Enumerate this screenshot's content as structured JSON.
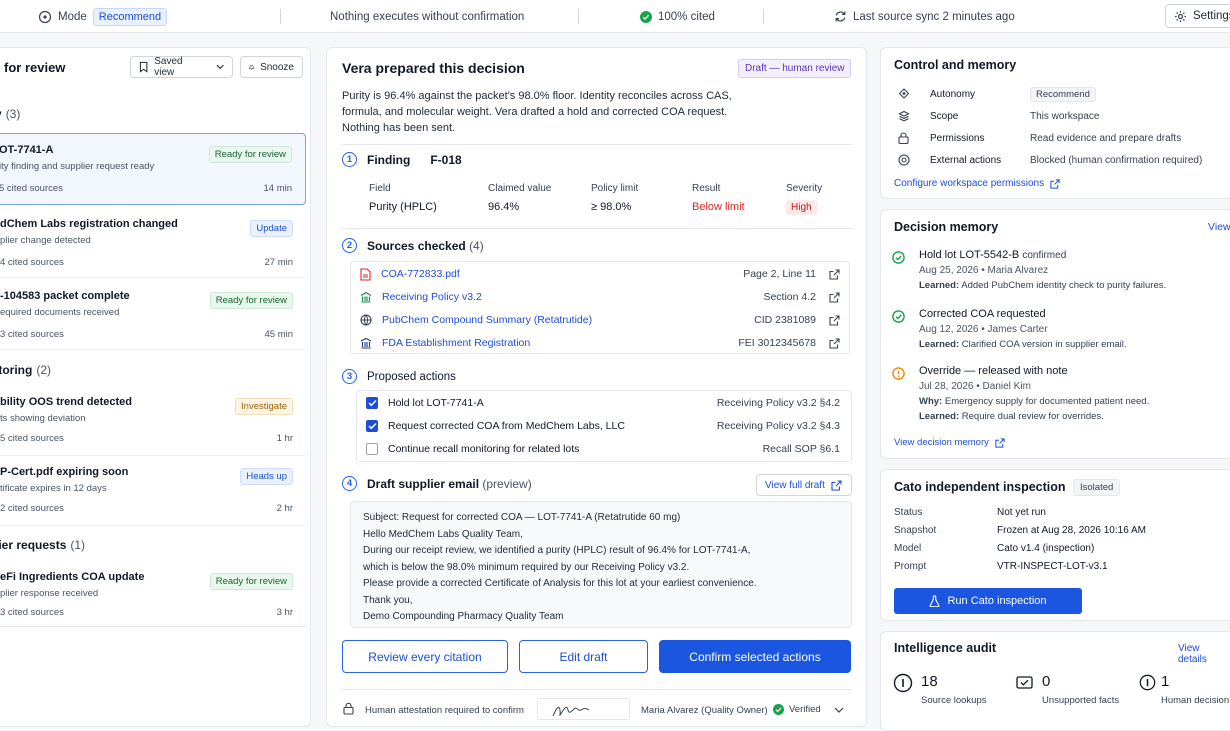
{
  "topbar": {
    "mode_label": "Mode",
    "mode_value": "Recommend",
    "notice": "Nothing executes without confirmation",
    "cited": "100% cited",
    "sync": "Last source sync 2 minutes ago",
    "settings": "Settings"
  },
  "queue": {
    "title": "for review",
    "saved_view": "Saved view",
    "snooze": "Snooze",
    "groups": [
      {
        "name": "y",
        "count": "(3)"
      },
      {
        "name": "itoring",
        "count": "(2)"
      },
      {
        "name": "lier requests",
        "count": "(1)"
      }
    ],
    "items": [
      {
        "title": "OT-7741-A",
        "sub": "ity finding and supplier request ready",
        "sources": "5 cited sources",
        "time": "14 min",
        "badge": "Ready for review",
        "badge_color": "green"
      },
      {
        "title": "dChem Labs registration changed",
        "sub": "plier change detected",
        "sources": "4 cited sources",
        "time": "27 min",
        "badge": "Update",
        "badge_color": "blue"
      },
      {
        "title": "-104583 packet complete",
        "sub": "equired documents received",
        "sources": "3 cited sources",
        "time": "45 min",
        "badge": "Ready for review",
        "badge_color": "green"
      },
      {
        "title": "bility OOS trend detected",
        "sub": "ts showing deviation",
        "sources": "5 cited sources",
        "time": "1 hr",
        "badge": "Investigate",
        "badge_color": "amber"
      },
      {
        "title": "P-Cert.pdf expiring soon",
        "sub": "tificate expires in 12 days",
        "sources": "2 cited sources",
        "time": "2 hr",
        "badge": "Heads up",
        "badge_color": "blue"
      },
      {
        "title": "eFi Ingredients COA update",
        "sub": "plier response received",
        "sources": "3 cited sources",
        "time": "3 hr",
        "badge": "Ready for review",
        "badge_color": "green"
      }
    ]
  },
  "decision": {
    "title": "Vera prepared this decision",
    "status": "Draft — human review",
    "summary_line1": "Purity is 96.4% against the packet's 98.0% floor. Identity reconciles across CAS,",
    "summary_line2": "formula, and molecular weight. Vera drafted a hold and corrected COA request.",
    "summary_line3": "Nothing has been sent.",
    "finding": {
      "num": "1",
      "label": "Finding",
      "id": "F-018",
      "headers": [
        "Field",
        "Claimed value",
        "Policy limit",
        "Result",
        "Severity"
      ],
      "values": [
        "Purity (HPLC)",
        "96.4%",
        "≥ 98.0%",
        "Below limit",
        "High"
      ]
    },
    "sources": {
      "num": "2",
      "label": "Sources checked",
      "count": "(4)",
      "rows": [
        {
          "name": "COA-772833.pdf",
          "loc": "Page 2, Line 11",
          "icon": "pdf-icon"
        },
        {
          "name": "Receiving Policy v3.2",
          "loc": "Section 4.2",
          "icon": "building-icon"
        },
        {
          "name": "PubChem Compound Summary (Retatrutide)",
          "loc": "CID 2381089",
          "icon": "globe-icon"
        },
        {
          "name": "FDA Establishment Registration",
          "loc": "FEI 3012345678",
          "icon": "registry-icon"
        }
      ]
    },
    "actions": {
      "num": "3",
      "label": "Proposed actions",
      "rows": [
        {
          "label": "Hold lot LOT-7741-A",
          "ref": "Receiving Policy v3.2 §4.2",
          "checked": true
        },
        {
          "label": "Request corrected COA from MedChem Labs, LLC",
          "ref": "Receiving Policy v3.2 §4.3",
          "checked": true
        },
        {
          "label": "Continue recall monitoring for related lots",
          "ref": "Recall SOP §6.1",
          "checked": false
        }
      ]
    },
    "email": {
      "num": "4",
      "label": "Draft supplier email",
      "preview": "(preview)",
      "view_full": "View full draft",
      "lines": [
        "Subject: Request for corrected COA — LOT-7741-A (Retatrutide 60 mg)",
        "Hello MedChem Labs Quality Team,",
        "During our receipt review, we identified a purity (HPLC) result of 96.4% for LOT-7741-A,",
        "which is below the 98.0% minimum required by our Receiving Policy v3.2.",
        "Please provide a corrected Certificate of Analysis for this lot at your earliest convenience.",
        "Thank you,",
        "Demo Compounding Pharmacy Quality Team"
      ]
    },
    "buttons": {
      "review": "Review every citation",
      "edit": "Edit draft",
      "confirm": "Confirm selected actions"
    },
    "attest": {
      "text": "Human attestation required to confirm",
      "signer": "Maria Alvarez (Quality Owner)",
      "verified": "Verified"
    }
  },
  "control": {
    "title": "Control and memory",
    "rows": [
      {
        "label": "Autonomy",
        "value": "Recommend",
        "icon": "autonomy-icon"
      },
      {
        "label": "Scope",
        "value": "This workspace",
        "icon": "scope-icon"
      },
      {
        "label": "Permissions",
        "value": "Read evidence and prepare drafts",
        "icon": "lock-icon"
      },
      {
        "label": "External actions",
        "value": "Blocked (human confirmation required)",
        "icon": "blocked-icon"
      }
    ],
    "link": "Configure workspace permissions"
  },
  "memory": {
    "title": "Decision memory",
    "view": "View",
    "items": [
      {
        "title": "Hold lot LOT-5542-B",
        "suffix": "confirmed",
        "meta": "Aug 25, 2026   •   Maria Alvarez",
        "learned_label": "Learned:",
        "learned": "Added PubChem identity check to purity failures.",
        "status": "ok"
      },
      {
        "title": "Corrected COA requested",
        "suffix": "",
        "meta": "Aug 12, 2026   •   James Carter",
        "learned_label": "Learned:",
        "learned": "Clarified COA version in supplier email.",
        "status": "ok"
      },
      {
        "title": "Override — released with note",
        "suffix": "",
        "meta": "Jul 28, 2026   •   Daniel Kim",
        "why_label": "Why:",
        "why": "Emergency supply for documented patient need.",
        "learned_label": "Learned:",
        "learned": "Require dual review for overrides.",
        "status": "warn"
      }
    ],
    "link": "View decision memory"
  },
  "cato": {
    "title": "Cato independent inspection",
    "tag": "Isolated",
    "rows": [
      {
        "label": "Status",
        "value": "Not yet run"
      },
      {
        "label": "Snapshot",
        "value": "Frozen at Aug 28, 2026 10:16 AM"
      },
      {
        "label": "Model",
        "value": "Cato v1.4 (inspection)"
      },
      {
        "label": "Prompt",
        "value": "VTR-INSPECT-LOT-v3.1"
      }
    ],
    "button": "Run Cato inspection"
  },
  "audit": {
    "title": "Intelligence audit",
    "link": "View details",
    "stats": [
      {
        "value": "18",
        "label": "Source lookups"
      },
      {
        "value": "0",
        "label": "Unsupported facts"
      },
      {
        "value": "1",
        "label": "Human decision"
      }
    ]
  },
  "colors": {
    "accent": "#1d4ed8",
    "danger": "#dc2626",
    "success": "#16a34a",
    "warning": "#ea8a0c"
  }
}
